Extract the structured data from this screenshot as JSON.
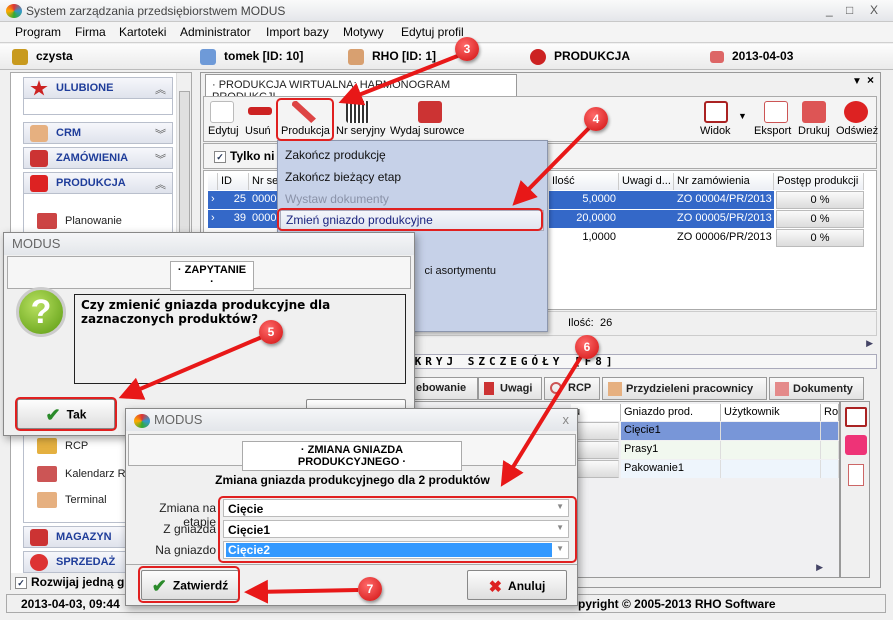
{
  "window": {
    "title": "System zarządzania przedsiębiorstwem MODUS",
    "controls": [
      "_",
      "□",
      "X"
    ]
  },
  "menu": [
    "Program",
    "Firma",
    "Kartoteki",
    "Administrator",
    "Import bazy",
    "Motywy",
    "Edytuj profil"
  ],
  "info": {
    "database": "czysta",
    "user": "tomek [ID: 10]",
    "company": "RHO [ID: 1]",
    "module": "PRODUKCJA",
    "date": "2013-04-03"
  },
  "sidebar": {
    "groups": {
      "favorites": "ULUBIONE",
      "crm": "CRM",
      "orders": "ZAMÓWIENIA",
      "production": "PRODUKCJA",
      "warehouse": "MAGAZYN",
      "sales": "SPRZEDAŻ"
    },
    "production_items": [
      "Planowanie",
      "RCP",
      "Kalendarz RC",
      "Terminal"
    ],
    "expand_one_label": "Rozwijaj jedną gr",
    "expand_one_checked": true
  },
  "tab": {
    "title": "· PRODUKCJA WIRTUALNA: HARMONOGRAM PRODUKCJI ·"
  },
  "toolbar": {
    "edit": "Edytuj",
    "delete": "Usuń",
    "production": "Produkcja",
    "serial": "Nr seryjny",
    "issue": "Wydaj surowce",
    "view": "Widok",
    "export": "Eksport",
    "print": "Drukuj",
    "refresh": "Odśwież"
  },
  "filter": {
    "label": "Tylko ni",
    "checked": true
  },
  "grid": {
    "columns": [
      "ID",
      "Nr ser",
      "Ilość",
      "Uwagi d...",
      "Nr zamówienia",
      "Postęp produkcji"
    ],
    "rows": [
      {
        "id": "25",
        "serial": "00000",
        "qty": "5,0000",
        "notes": "",
        "order": "ZO 00004/PR/2013",
        "progress": "0 %",
        "selected": true
      },
      {
        "id": "39",
        "serial": "00000",
        "qty": "20,0000",
        "notes": "",
        "order": "ZO 00005/PR/2013",
        "progress": "0 %",
        "selected": true
      },
      {
        "id": "",
        "serial": "",
        "qty": "1,0000",
        "notes": "",
        "order": "ZO 00006/PR/2013",
        "progress": "0 %",
        "selected": false
      }
    ],
    "count_label": "Ilość:",
    "count": "26"
  },
  "production_menu": {
    "items": [
      "Zakończ produkcję",
      "Zakończ bieżący etap",
      "Wystaw dokumenty",
      "Zmień gniazdo produkcyjne",
      "ci asortymentu"
    ],
    "disabled": [
      2
    ]
  },
  "details": {
    "toggle": "UKRYJ SZCZEGÓŁY [F8]",
    "tabs": [
      "ebowanie",
      "Uwagi",
      "RCP",
      "Przydzieleni pracownicy",
      "Dokumenty"
    ],
    "columns": [
      "u",
      "Gniazdo prod.",
      "Użytkownik",
      "Roz"
    ],
    "rows": [
      {
        "workstation": "Cięcie1"
      },
      {
        "workstation": "Prasy1"
      },
      {
        "workstation": "Pakowanie1"
      }
    ]
  },
  "statusbar": {
    "datetime": "2013-04-03, 09:44",
    "copyright": "pyright © 2005-2013 RHO Software"
  },
  "confirm_dialog": {
    "title": "MODUS",
    "header": "· ZAPYTANIE ·",
    "message": "Czy zmienić gniazda produkcyjne dla zaznaczonych produktów?",
    "yes": "Tak"
  },
  "change_dialog": {
    "title": "MODUS",
    "header": "· ZMIANA GNIAZDA PRODUKCYJNEGO ·",
    "subtitle": "Zmiana gniazda produkcyjnego dla 2 produktów",
    "fields": [
      {
        "label": "Zmiana na etapie",
        "value": "Cięcie"
      },
      {
        "label": "Z gniazda",
        "value": "Cięcie1"
      },
      {
        "label": "Na gniazdo",
        "value": "Cięcie2"
      }
    ],
    "confirm": "Zatwierdź",
    "cancel": "Anuluj",
    "close": "x"
  },
  "annotations": [
    "3",
    "4",
    "5",
    "6",
    "7"
  ],
  "colors": {
    "selection": "#3468c8",
    "highlight": "#e02020",
    "group_text": "#1f3d9a",
    "menu_bg": "#c6d1e8"
  }
}
